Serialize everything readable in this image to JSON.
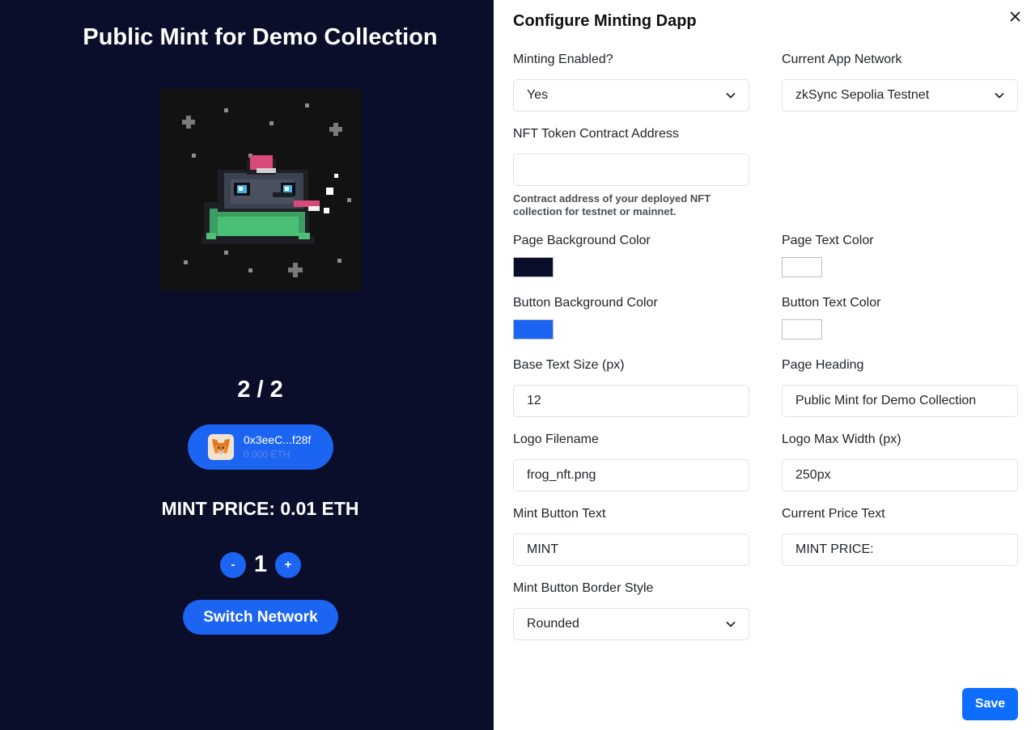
{
  "preview": {
    "heading": "Public Mint for Demo Collection",
    "counter": "2 / 2",
    "wallet": {
      "address": "0x3eeC...f28f",
      "balance": "0.000 ETH"
    },
    "price_line": "MINT PRICE: 0.01 ETH",
    "quantity": {
      "decrement": "-",
      "value": "1",
      "increment": "+"
    },
    "switch_network_label": "Switch Network"
  },
  "panel": {
    "title": "Configure Minting Dapp",
    "close_icon": "close-icon",
    "fields": {
      "minting_enabled": {
        "label": "Minting Enabled?",
        "value": "Yes"
      },
      "network": {
        "label": "Current App Network",
        "value": "zkSync Sepolia Testnet"
      },
      "contract": {
        "label": "NFT Token Contract Address",
        "value": "",
        "help": "Contract address of your deployed NFT collection for testnet or mainnet."
      },
      "page_bg": {
        "label": "Page Background Color",
        "color": "#0a0e2b"
      },
      "page_text": {
        "label": "Page Text Color",
        "color": "#ffffff"
      },
      "button_bg": {
        "label": "Button Background Color",
        "color": "#1c64f2"
      },
      "button_text": {
        "label": "Button Text Color",
        "color": "#ffffff"
      },
      "base_text_size": {
        "label": "Base Text Size (px)",
        "value": "12"
      },
      "page_heading": {
        "label": "Page Heading",
        "value": "Public Mint for Demo Collection"
      },
      "logo_filename": {
        "label": "Logo Filename",
        "value": "frog_nft.png"
      },
      "logo_max_width": {
        "label": "Logo Max Width (px)",
        "value": "250px"
      },
      "mint_button_text": {
        "label": "Mint Button Text",
        "value": "MINT"
      },
      "current_price_text": {
        "label": "Current Price Text",
        "value": "MINT PRICE:"
      },
      "border_style": {
        "label": "Mint Button Border Style",
        "value": "Rounded"
      }
    },
    "save_label": "Save"
  }
}
